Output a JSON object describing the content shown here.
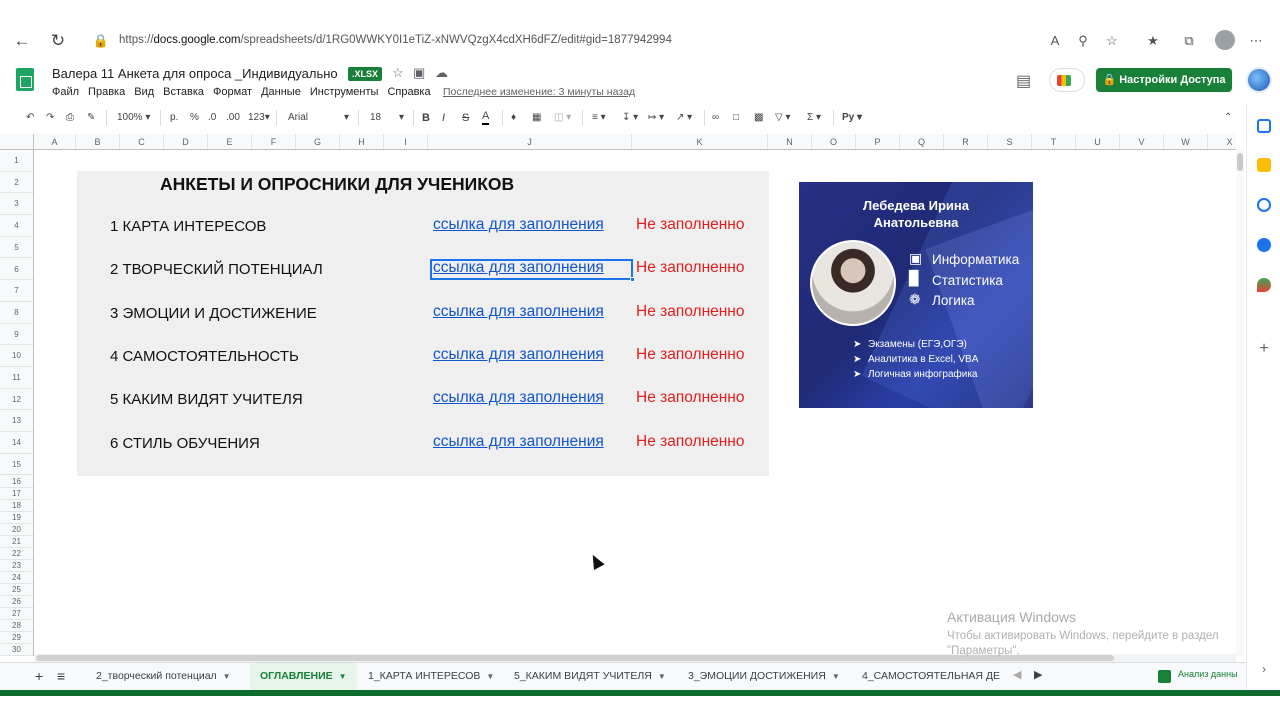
{
  "browser": {
    "url_prefix": "https://",
    "url_domain": "docs.google.com",
    "url_rest": "/spreadsheets/d/1RG0WWKY0I1eTiZ-xNWVQzgX4cdXH6dFZ/edit#gid=1877942994"
  },
  "doc": {
    "title": "Валера 11  Анкета для опроса _Индивидуально",
    "badge": ".XLSX",
    "last_edit": "Последнее изменение: 3 минуты назад",
    "share_label": "Настройки Доступа"
  },
  "menu": [
    "Файл",
    "Правка",
    "Вид",
    "Вставка",
    "Формат",
    "Данные",
    "Инструменты",
    "Справка"
  ],
  "toolbar": {
    "zoom": "100%",
    "currency": "р.",
    "percent": "%",
    "dec_less": ".0",
    "dec_more": ".00",
    "format_more": "123",
    "font": "Arial",
    "font_size": "18",
    "bold": "B",
    "italic": "I",
    "strike": "S",
    "text_color": "A"
  },
  "columns": [
    "A",
    "B",
    "C",
    "D",
    "E",
    "F",
    "G",
    "H",
    "I",
    "J",
    "K",
    "N",
    "O",
    "P",
    "Q",
    "R",
    "S",
    "T",
    "U",
    "V",
    "W",
    "X"
  ],
  "rows": [
    "1",
    "2",
    "3",
    "4",
    "5",
    "6",
    "7",
    "8",
    "9",
    "10",
    "11",
    "12",
    "13",
    "14",
    "15",
    "16",
    "17",
    "18",
    "19",
    "20",
    "21",
    "22",
    "23",
    "24",
    "25",
    "26",
    "27",
    "28",
    "29",
    "30"
  ],
  "sheet": {
    "title": "АНКЕТЫ И ОПРОСНИКИ ДЛЯ УЧЕНИКОВ",
    "surveys": [
      {
        "name": "1 КАРТА ИНТЕРЕСОВ",
        "link": "ссылка для заполнения",
        "status": "Не заполненно"
      },
      {
        "name": "2 ТВОРЧЕСКИЙ ПОТЕНЦИАЛ",
        "link": "ссылка для заполнения",
        "status": "Не заполненно"
      },
      {
        "name": "3 ЭМОЦИИ И ДОСТИЖЕНИЕ",
        "link": "ссылка для заполнения",
        "status": "Не заполненно"
      },
      {
        "name": "4 САМОСТОЯТЕЛЬНОСТЬ",
        "link": "ссылка для заполнения",
        "status": "Не заполненно"
      },
      {
        "name": "5 КАКИМ ВИДЯТ УЧИТЕЛЯ",
        "link": "ссылка для заполнения",
        "status": "Не заполненно"
      },
      {
        "name": "6  СТИЛЬ ОБУЧЕНИЯ",
        "link": "ссылка для заполнения",
        "status": "Не заполненно"
      }
    ]
  },
  "promo": {
    "name_line1": "Лебедева Ирина",
    "name_line2": "Анатольевна",
    "subjects": [
      "Информатика",
      "Статистика",
      "Логика"
    ],
    "services": [
      "Экзамены (ЕГЭ,ОГЭ)",
      "Аналитика в Excel, VBA",
      "Логичная инфографика"
    ]
  },
  "tabs": [
    {
      "label": "2_творческий потенциал",
      "active": false
    },
    {
      "label": "ОГЛАВЛЕНИЕ",
      "active": true
    },
    {
      "label": "1_КАРТА ИНТЕРЕСОВ",
      "active": false
    },
    {
      "label": "5_КАКИМ ВИДЯТ УЧИТЕЛЯ",
      "active": false
    },
    {
      "label": "3_ЭМОЦИИ ДОСТИЖЕНИЯ",
      "active": false
    },
    {
      "label": "4_САМОСТОЯТЕЛЬНАЯ ДЕ",
      "active": false
    }
  ],
  "explore_label": "Анализ данны",
  "watermark": {
    "title": "Активация Windows",
    "line1": "Чтобы активировать Windows, перейдите в раздел",
    "line2": "\"Параметры\"."
  },
  "colors": {
    "brand_green": "#188038",
    "link_blue": "#1155cc",
    "status_red": "#e02020",
    "selection_blue": "#1a73e8"
  }
}
